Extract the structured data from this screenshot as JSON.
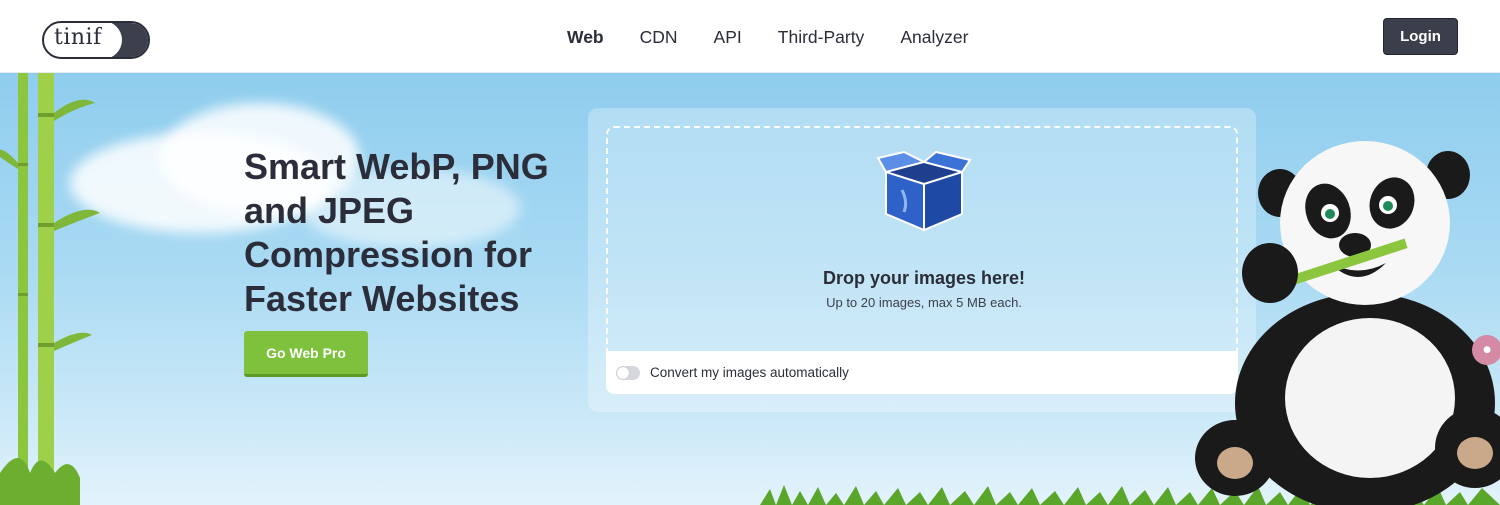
{
  "header": {
    "logo_text": "tinify",
    "nav": [
      {
        "label": "Web",
        "active": true
      },
      {
        "label": "CDN",
        "active": false
      },
      {
        "label": "API",
        "active": false
      },
      {
        "label": "Third-Party",
        "active": false
      },
      {
        "label": "Analyzer",
        "active": false
      }
    ],
    "login_label": "Login"
  },
  "hero": {
    "headline_lines": [
      "Smart WebP, PNG",
      "and JPEG",
      "Compression for",
      "Faster Websites"
    ],
    "cta_label": "Go Web Pro"
  },
  "dropzone": {
    "title": "Drop your images here!",
    "subtitle": "Up to 20 images, max 5 MB each.",
    "convert_label": "Convert my images automatically",
    "convert_enabled": false
  },
  "icons": {
    "box": "open-box-icon",
    "mascot": "panda-mascot"
  },
  "colors": {
    "accent_green": "#7ec13c",
    "dark": "#3b3f4c",
    "sky": "#8fcdee"
  }
}
